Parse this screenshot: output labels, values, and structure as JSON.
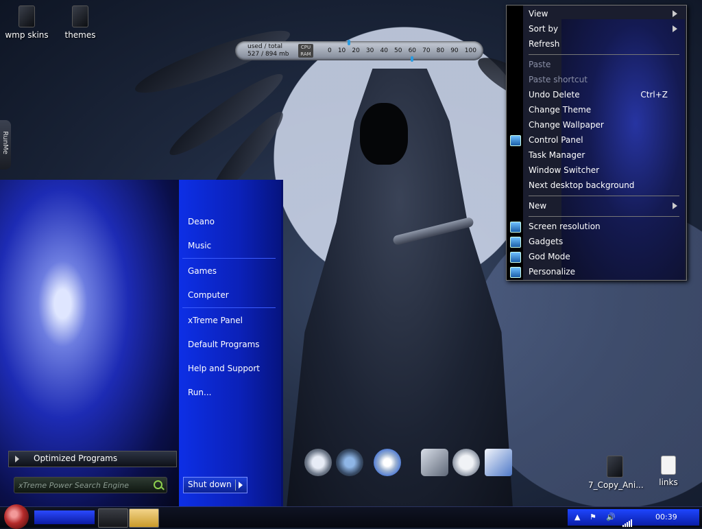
{
  "desktop": {
    "icons": [
      {
        "label": "wmp skins"
      },
      {
        "label": "themes"
      },
      {
        "label": "7_Copy_Ani..."
      },
      {
        "label": "links"
      }
    ],
    "side_tab": "RunMe"
  },
  "meter": {
    "used_label": "used",
    "sep": "/",
    "total_label": "total",
    "used_value": "527",
    "total_value": "/ 894",
    "unit": "mb",
    "cpu_label": "CPU",
    "ram_label": "RAM",
    "scale": [
      "0",
      "10",
      "20",
      "30",
      "40",
      "50",
      "60",
      "70",
      "80",
      "90",
      "100"
    ]
  },
  "context_menu": {
    "items": [
      {
        "label": "View",
        "submenu": true
      },
      {
        "label": "Sort by",
        "submenu": true
      },
      {
        "label": "Refresh"
      },
      {
        "label": "Paste",
        "disabled": true
      },
      {
        "label": "Paste shortcut",
        "disabled": true
      },
      {
        "label": "Undo Delete",
        "shortcut": "Ctrl+Z"
      },
      {
        "label": "Change Theme"
      },
      {
        "label": "Change Wallpaper"
      },
      {
        "label": "Control Panel",
        "icon": "control-panel-icon"
      },
      {
        "label": "Task Manager"
      },
      {
        "label": "Window Switcher"
      },
      {
        "label": "Next desktop background"
      },
      {
        "label": "New",
        "submenu": true
      },
      {
        "label": "Screen resolution",
        "icon": "screen-resolution-icon"
      },
      {
        "label": "Gadgets",
        "icon": "gadgets-icon"
      },
      {
        "label": "God Mode",
        "icon": "god-mode-icon"
      },
      {
        "label": "Personalize",
        "icon": "personalize-icon"
      }
    ]
  },
  "start_menu": {
    "links": [
      "Deano",
      "Music",
      "Games",
      "Computer",
      "xTreme Panel",
      "Default Programs",
      "Help and Support",
      "Run..."
    ],
    "optimized_programs": "Optimized Programs",
    "search_placeholder": "xTreme Power Search Engine",
    "shutdown_label": "Shut down"
  },
  "taskbar": {
    "clock": "00:39"
  },
  "colors": {
    "accent_blue": "#0b21b8",
    "taskbar_bg": "#060810",
    "orb_red": "#b42a2a"
  }
}
